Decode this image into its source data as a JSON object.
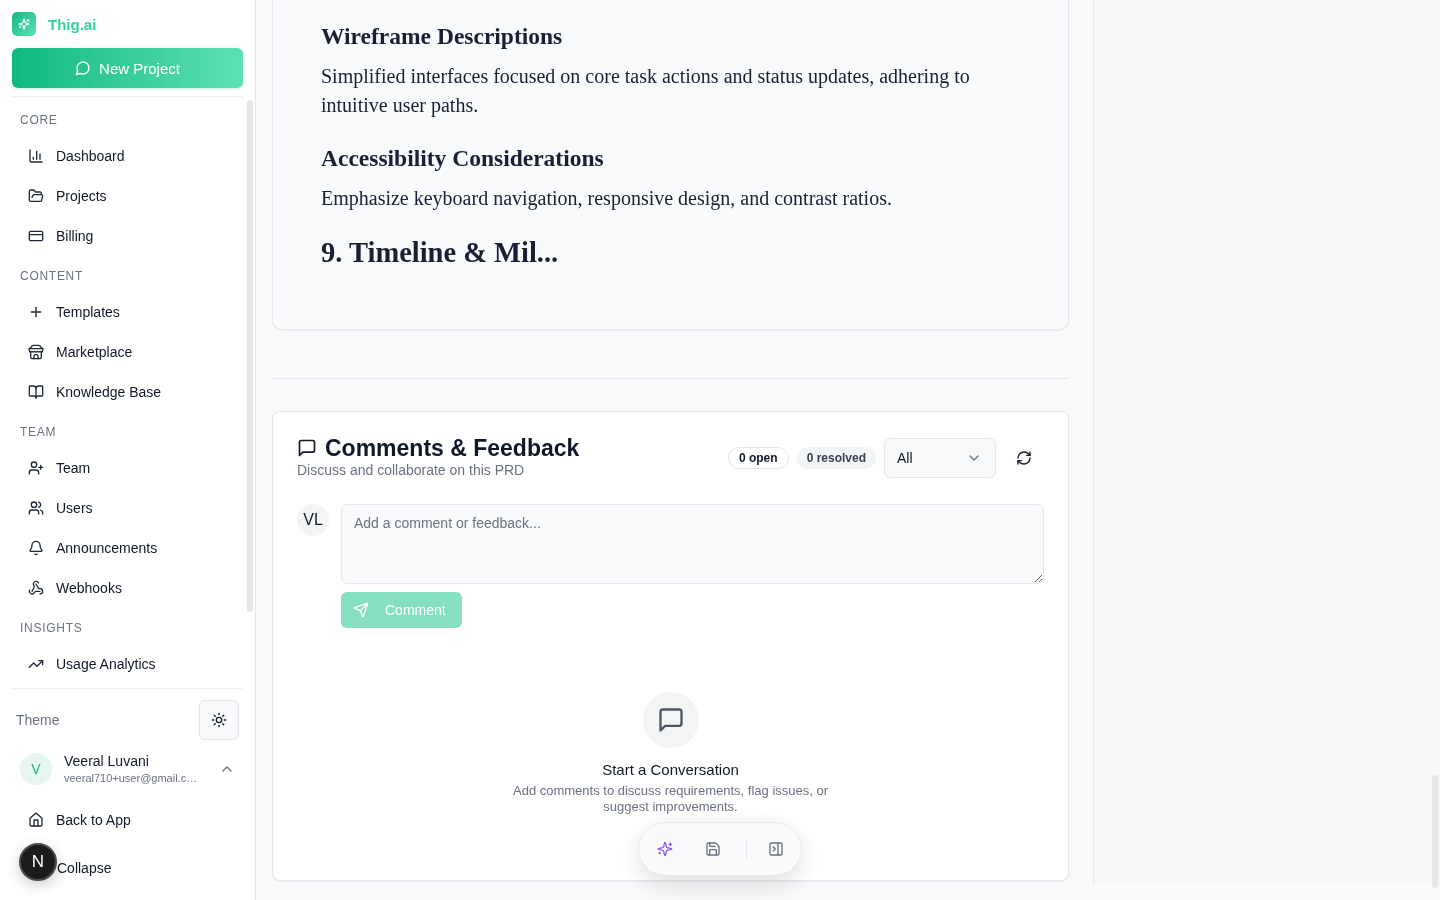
{
  "sidebar": {
    "brand": "Thig.ai",
    "new_project_button": "New Project",
    "sections": [
      {
        "title": "CORE",
        "items": [
          {
            "label": "Dashboard",
            "selected": false
          },
          {
            "label": "Projects",
            "selected": false
          },
          {
            "label": "Billing",
            "selected": false
          }
        ]
      },
      {
        "title": "CONTENT",
        "items": [
          {
            "label": "Templates",
            "selected": false
          },
          {
            "label": "Marketplace",
            "selected": false
          },
          {
            "label": "Knowledge Base",
            "selected": false
          }
        ]
      },
      {
        "title": "TEAM",
        "items": [
          {
            "label": "Team",
            "selected": false
          },
          {
            "label": "Users",
            "selected": false
          },
          {
            "label": "Announcements",
            "selected": false
          },
          {
            "label": "Webhooks",
            "selected": false
          }
        ]
      },
      {
        "title": "INSIGHTS",
        "items": [
          {
            "label": "Usage Analytics",
            "selected": false
          }
        ]
      }
    ],
    "theme": {
      "label": "Theme"
    },
    "user": {
      "initial": "V",
      "name": "Veeral Luvani",
      "email": "veeral710+user@gmail.c…"
    },
    "footer_items": [
      {
        "kind": "home",
        "label": "Back to App"
      },
      {
        "kind": "collapse",
        "label": "Collapse"
      }
    ]
  },
  "document": {
    "blocks": [
      {
        "kind": "heading",
        "text": "Wireframe Descriptions"
      },
      {
        "kind": "paragraph",
        "text": "Simplified interfaces focused on core task actions and status updates, adhering to intuitive user paths."
      },
      {
        "kind": "heading",
        "text": "Accessibility Considerations"
      },
      {
        "kind": "paragraph",
        "text": "Emphasize keyboard navigation, responsive design, and contrast ratios."
      },
      {
        "kind": "section_heading",
        "text": "9. Timeline & Mil..."
      }
    ]
  },
  "comments": {
    "title": "Comments & Feedback",
    "subtitle": "Discuss and collaborate on this PRD",
    "badges": [
      {
        "kind": "outline",
        "label": "0 open"
      },
      {
        "kind": "muted",
        "label": "0 resolved"
      }
    ],
    "filter": {
      "value": "All"
    },
    "composer": {
      "avatar": "VL",
      "placeholder": "Add a comment or feedback...",
      "button": {
        "label": "Comment",
        "disabled": true
      }
    },
    "empty_state": {
      "title": "Start a Conversation",
      "text": "Add comments to discuss requirements, flag issues, or suggest improvements."
    }
  },
  "dev_indicator": {
    "label": "N"
  }
}
